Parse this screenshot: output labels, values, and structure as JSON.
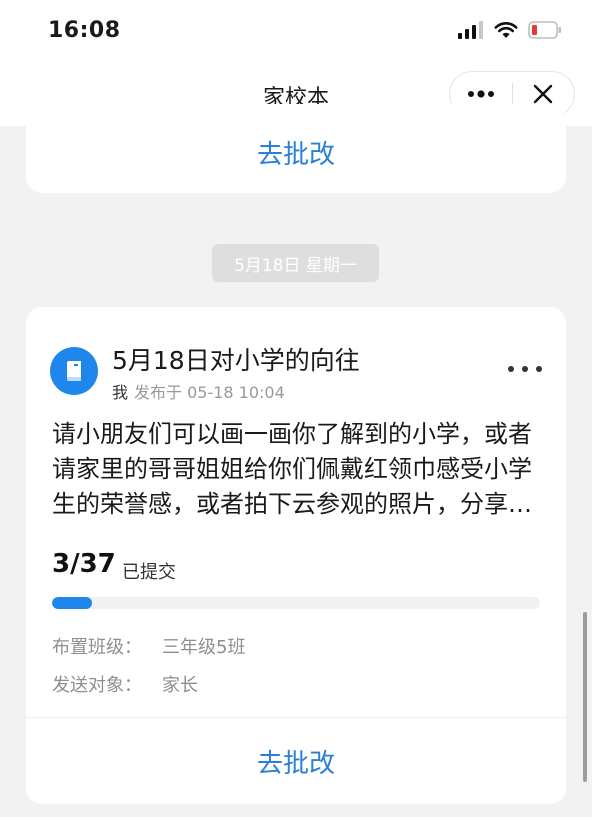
{
  "status_bar": {
    "time": "16:08"
  },
  "navbar": {
    "title": "家校本"
  },
  "prev_card": {
    "review_label": "去批改"
  },
  "date_chip": "5月18日  星期一",
  "homework": {
    "title": "5月18日对小学的向往",
    "author": "我",
    "published": "发布于 05-18 10:04",
    "description": "请小朋友们可以画一画你了解到的小学，或者请家里的哥哥姐姐给你们佩戴红领巾感受小学生的荣誉感，或者拍下云参观的照片，分享一下你心目中的小学吧。",
    "submitted_count": "3/37",
    "submitted_label": "已提交",
    "progress": 0.081,
    "class_label": "布置班级：",
    "class_value": "三年级5班",
    "target_label": "发送对象：",
    "target_value": "家长",
    "review_label": "去批改"
  },
  "colors": {
    "accent": "#1f86ec",
    "link": "#2a7fd6"
  }
}
